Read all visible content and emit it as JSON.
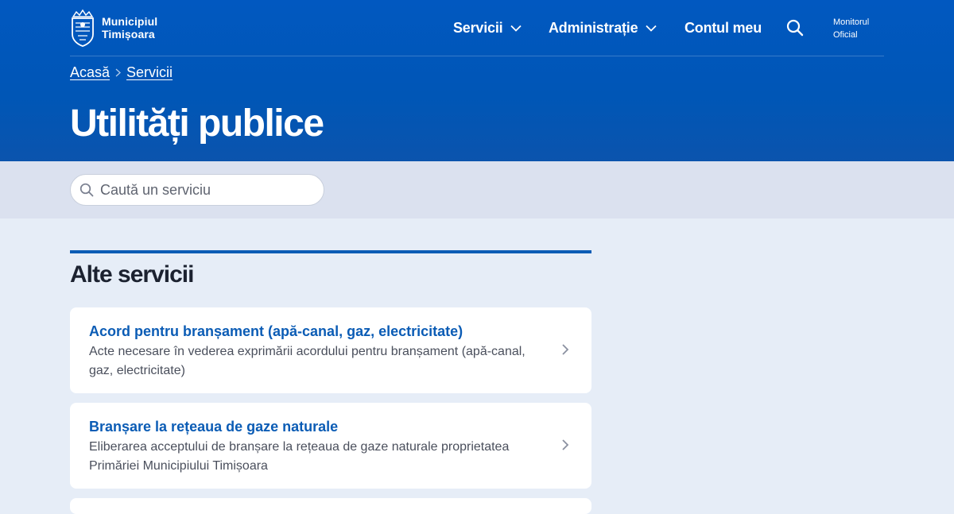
{
  "header": {
    "logo_line1": "Municipiul",
    "logo_line2": "Timișoara",
    "nav": {
      "servicii": "Servicii",
      "administratie": "Administrație",
      "cont": "Contul meu"
    },
    "monitor_line1": "Monitorul",
    "monitor_line2": "Oficial"
  },
  "breadcrumb": {
    "home": "Acasă",
    "current": "Servicii"
  },
  "page_title": "Utilități publice",
  "search": {
    "placeholder": "Caută un serviciu",
    "value": ""
  },
  "section": {
    "title": "Alte servicii"
  },
  "cards": [
    {
      "title": "Acord pentru branșament (apă-canal, gaz, electricitate)",
      "description": "Acte necesare în vederea exprimării acordului pentru branșament (apă-canal, gaz, electricitate)"
    },
    {
      "title": "Branșare la rețeaua de gaze naturale",
      "description": "Eliberarea acceptului de branșare la rețeaua de gaze naturale proprietatea Primăriei Municipiului Timișoara"
    }
  ],
  "colors": {
    "brand_blue": "#0158c0",
    "link_blue": "#0b5cb5",
    "page_bg": "#e6edf7",
    "search_band": "#dbe1ef"
  }
}
